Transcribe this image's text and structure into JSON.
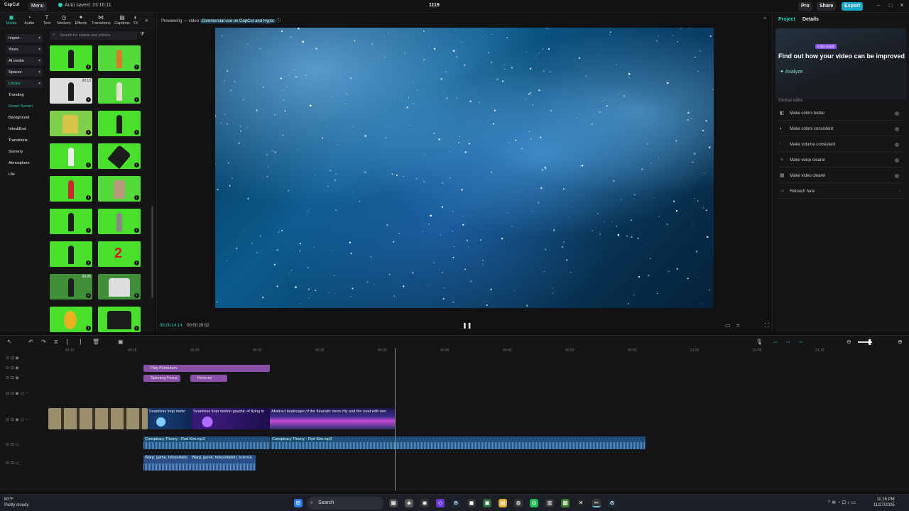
{
  "titlebar": {
    "logo": "CapCut",
    "menu": "Menu",
    "saved": "Auto saved: 23:16:11",
    "project": "1119",
    "pro": "Pro",
    "share": "Share",
    "export": "Export"
  },
  "tools": [
    {
      "label": "Media",
      "icon": "media-icon"
    },
    {
      "label": "Audio",
      "icon": "audio-icon"
    },
    {
      "label": "Text",
      "icon": "text-icon"
    },
    {
      "label": "Stickers",
      "icon": "sticker-icon"
    },
    {
      "label": "Effects",
      "icon": "effects-icon"
    },
    {
      "label": "Transitions",
      "icon": "transition-icon"
    },
    {
      "label": "Captions",
      "icon": "captions-icon"
    },
    {
      "label": "Fil",
      "icon": "filter-icon"
    }
  ],
  "sidebar": {
    "items": [
      {
        "label": "Import"
      },
      {
        "label": "Yours"
      },
      {
        "label": "AI media"
      },
      {
        "label": "Spaces"
      },
      {
        "label": "Library"
      },
      {
        "label": "Trending"
      },
      {
        "label": "Green Screen"
      },
      {
        "label": "Background"
      },
      {
        "label": "Intro&End"
      },
      {
        "label": "Transitions"
      },
      {
        "label": "Scenery"
      },
      {
        "label": "Atmosphere"
      },
      {
        "label": "Life"
      }
    ]
  },
  "media": {
    "search_placeholder": "Search for videos and photos",
    "durations": [
      "00:10",
      "00:26"
    ]
  },
  "preview": {
    "label": "Previewing — video",
    "tag": "Commercial use on CapCut and Hypic",
    "time_current": "00:00:14:14",
    "time_total": "00:00:20:02"
  },
  "right": {
    "tab_project": "Project",
    "tab_details": "Details",
    "badge": "s this month",
    "title": "Find out how your video can be improved",
    "analyze": "Analyze",
    "global_edits": "Global edits",
    "edits": [
      "Make colors better",
      "Make colors consistent",
      "Make volume consistent",
      "Make voice clearer",
      "Make video clearer",
      "Retouch face"
    ]
  },
  "timeline": {
    "ticks": [
      "00:10",
      "00:15",
      "00:20",
      "00:25",
      "00:30",
      "00:35",
      "00:40",
      "00:45",
      "00:50",
      "00:55",
      "01:00",
      "01:05",
      "01:10"
    ],
    "effects": [
      "Play Pendulum",
      "Spinning Focus",
      "Reverse"
    ],
    "video_clips": [
      "Seamless loop motio",
      "Seamless loop motion graphic of flying in",
      "Abstract landscape of the futuristic neon city and the road with neo"
    ],
    "audio1": "Conspiracy Theory - Rod Kim.mp3",
    "audio2": "Conspiracy Theory - Rod Kim.mp3",
    "sfx": [
      "Warp, game, teleportatio",
      "Warp, game, teleportation, science"
    ]
  },
  "taskbar": {
    "temp": "80°F",
    "weather": "Partly cloudy",
    "search": "Search",
    "time": "11:16 PM",
    "date": "11/27/2025"
  },
  "colors": {
    "accent": "#2ad0b3",
    "greenscreen": "#49e02c",
    "effect_clip": "#8a4fa6",
    "audio": "#1e4f78"
  }
}
